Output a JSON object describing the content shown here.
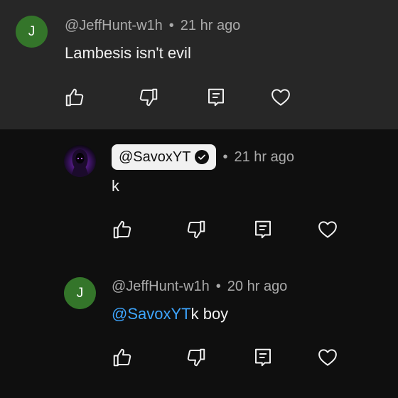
{
  "comments": [
    {
      "avatar_letter": "J",
      "author": "@JeffHunt-w1h",
      "time": "21 hr ago",
      "text": "Lambesis isn't evil"
    },
    {
      "author": "@SavoxYT",
      "time": "21 hr ago",
      "text": "k"
    },
    {
      "avatar_letter": "J",
      "author": "@JeffHunt-w1h",
      "time": "20 hr ago",
      "mention": "@SavoxYT",
      "text": "k boy"
    }
  ],
  "separator": "•",
  "colors": {
    "top_comment_bg": "#272727",
    "page_bg": "#0f0f0f",
    "avatar_green": "#34752a",
    "mention_blue": "#3ea6ff"
  },
  "icons": [
    "like-icon",
    "dislike-icon",
    "reply-icon",
    "heart-icon"
  ]
}
